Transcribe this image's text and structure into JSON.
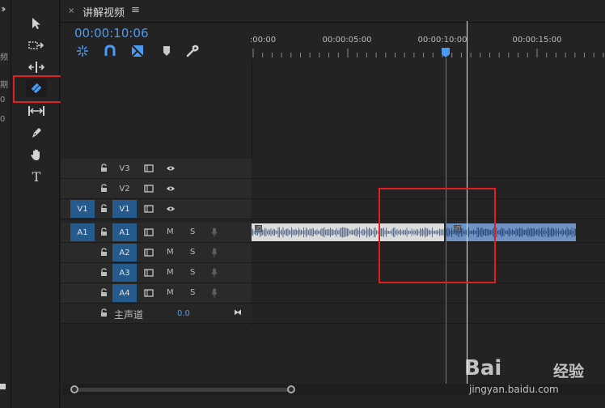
{
  "left_panel": {
    "collapse_icon": "double-chevron-right-icon",
    "fragments": [
      "频",
      "期",
      "0",
      "0"
    ]
  },
  "tools": [
    {
      "name": "selection-tool",
      "icon": "arrow-cursor-icon"
    },
    {
      "name": "track-select-tool",
      "icon": "track-select-icon"
    },
    {
      "name": "ripple-edit-tool",
      "icon": "ripple-edit-icon"
    },
    {
      "name": "razor-tool",
      "icon": "razor-icon",
      "active": true
    },
    {
      "name": "slip-tool",
      "icon": "slip-icon"
    },
    {
      "name": "pen-tool",
      "icon": "pen-icon"
    },
    {
      "name": "hand-tool",
      "icon": "hand-icon"
    },
    {
      "name": "type-tool",
      "icon": "type-icon",
      "label": "T"
    }
  ],
  "timeline": {
    "tab": {
      "close": "×",
      "title": "讲解视频",
      "menu": "≡"
    },
    "timecode": "00:00:10:06",
    "controls": [
      "nest-icon",
      "snap-magnet-icon",
      "linked-selection-icon",
      "marker-icon",
      "wrench-icon"
    ],
    "ruler_labels": [
      ":00:00",
      "00:00:05:00",
      "00:00:10:00",
      "00:00:15:00"
    ],
    "accent_color": "#4a9cf2"
  },
  "tracks": {
    "video": [
      {
        "name": "V3",
        "source": "",
        "selected": false
      },
      {
        "name": "V2",
        "source": "",
        "selected": false
      },
      {
        "name": "V1",
        "source": "V1",
        "selected": true
      }
    ],
    "audio": [
      {
        "name": "A1",
        "source": "A1",
        "selected": true,
        "mute": "M",
        "solo": "S"
      },
      {
        "name": "A2",
        "source": "",
        "selected": true,
        "mute": "M",
        "solo": "S"
      },
      {
        "name": "A3",
        "source": "",
        "selected": true,
        "mute": "M",
        "solo": "S"
      },
      {
        "name": "A4",
        "source": "",
        "selected": true,
        "mute": "M",
        "solo": "S"
      }
    ],
    "master": {
      "label": "主声道",
      "volume": "0.0",
      "end_icon": "⧓"
    }
  },
  "watermark": {
    "bai": "Bai",
    "jingyan": "经验",
    "url": "jingyan.baidu.com"
  }
}
